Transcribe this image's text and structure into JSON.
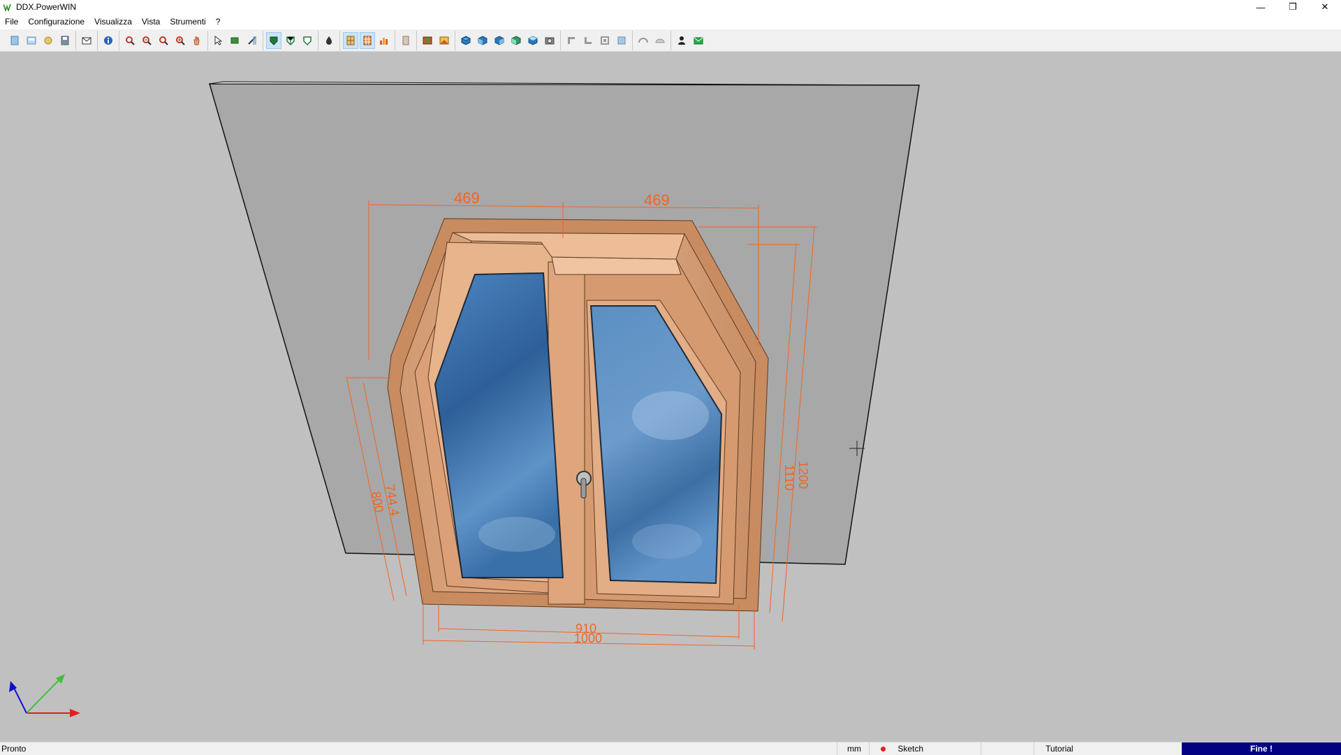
{
  "app": {
    "title": "DDX.PowerWIN"
  },
  "window_controls": {
    "minimize": "—",
    "restore": "❐",
    "close": "✕"
  },
  "menu": [
    "File",
    "Configurazione",
    "Visualizza",
    "Vista",
    "Strumenti",
    "?"
  ],
  "toolbar_icons": [
    [
      "new-icon",
      "open-icon",
      "open-folder-icon",
      "save-icon"
    ],
    [
      "email-icon"
    ],
    [
      "info-icon"
    ],
    [
      "zoom-window-icon",
      "zoom-all-icon",
      "zoom-out-icon",
      "zoom-in-icon",
      "pan-hand-icon"
    ],
    [
      "select-icon",
      "frame-icon",
      "measure-icon"
    ],
    [
      "shaded-view-icon",
      "wireframe-view-icon",
      "hidden-lines-icon"
    ],
    [
      "render-icon"
    ],
    [
      "window-frame-icon",
      "grid-frame-icon",
      "chart-icon"
    ],
    [
      "door-icon"
    ],
    [
      "image-icon",
      "texture-icon"
    ],
    [
      "view-top-icon",
      "view-front-icon",
      "view-right-icon",
      "view-left-icon",
      "view-iso-icon",
      "view-camera-icon"
    ],
    [
      "profile-l-icon",
      "profile-corner-icon",
      "profile-t-icon",
      "profile-square-icon"
    ],
    [
      "arc-icon",
      "semi-arc-icon"
    ],
    [
      "user-icon",
      "message-icon"
    ]
  ],
  "dimensions": {
    "top_left_width": "469",
    "top_right_width": "469",
    "inner_width": "910",
    "outer_width": "1000",
    "right_inner_height": "1110",
    "right_outer_height": "1200",
    "left_inner_height": "744.4",
    "left_outer_height": "800"
  },
  "colors": {
    "dimension": "#f26522",
    "wood_light": "#e8b48c",
    "wood_mid": "#d89a70",
    "wood_dark": "#b97a55",
    "glass": "#3a6ea5",
    "wall": "#a6a6a6",
    "background": "#c0c0c0"
  },
  "axes": {
    "x": "red-axis",
    "y": "green-axis",
    "z": "blue-axis"
  },
  "status": {
    "message": "Pronto",
    "unit": "mm",
    "mode": "Sketch",
    "project": "Tutorial",
    "progress_label": "Fine !"
  }
}
